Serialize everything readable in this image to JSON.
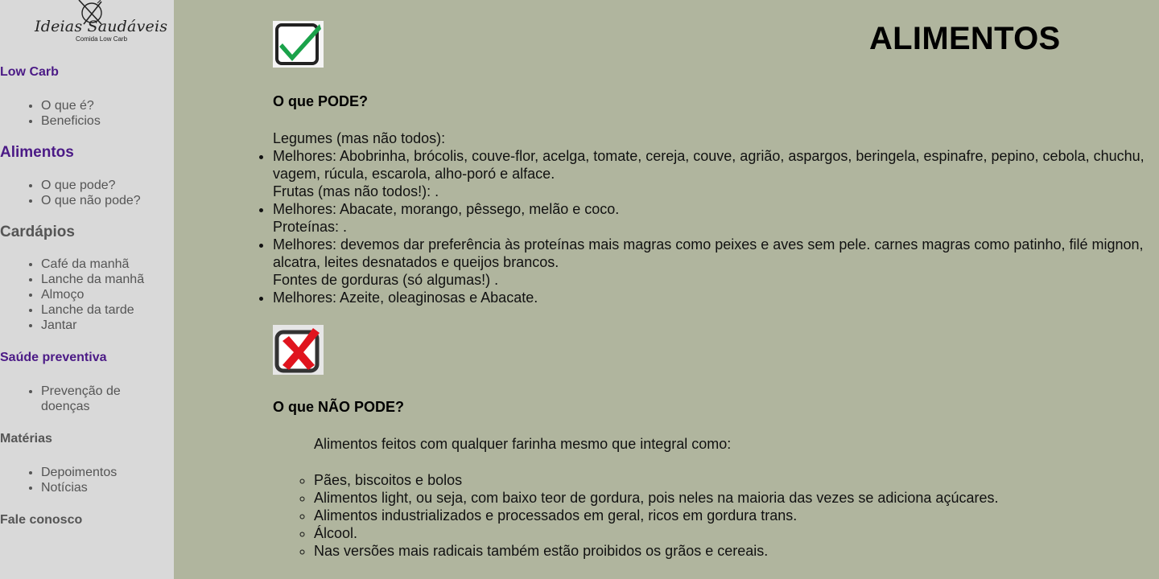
{
  "logo": {
    "script_text": "Ideias Saudáveis",
    "tagline": "Comida Low Carb",
    "icon": "fork-knife-plate-icon"
  },
  "sidebar": {
    "low_carb": {
      "title": "Low Carb",
      "items": [
        "O que é?",
        "Beneficios"
      ]
    },
    "alimentos": {
      "title": "Alimentos",
      "items": [
        "O que pode?",
        "O que não pode?"
      ]
    },
    "cardapios": {
      "title": "Cardápios",
      "items": [
        "Café da manhã",
        "Lanche da manhã",
        "Almoço",
        "Lanche da tarde",
        "Jantar"
      ]
    },
    "saude": {
      "title": "Saúde preventiva",
      "items": [
        "Prevenção de doenças"
      ]
    },
    "materias": {
      "title": "Matérias",
      "items": [
        "Depoimentos",
        "Notícias"
      ]
    },
    "fale": {
      "title": "Fale conosco"
    }
  },
  "main": {
    "title": "ALIMENTOS",
    "can": {
      "icon": "green-checkmark-icon",
      "heading": "O que PODE?",
      "groups": [
        {
          "category": "Legumes (mas não todos):",
          "best": "Melhores: Abobrinha, brócolis, couve-flor, acelga, tomate, cereja, couve, agrião, aspargos, beringela, espinafre, pepino, cebola, chuchu, vagem, rúcula, escarola, alho-poró e alface."
        },
        {
          "category": "Frutas (mas não todos!): .",
          "best": "Melhores: Abacate, morango, pêssego, melão e coco."
        },
        {
          "category": "Proteínas: .",
          "best": "Melhores: devemos dar preferência às proteínas mais magras como peixes e aves sem pele. carnes magras como patinho, filé mignon, alcatra, leites desnatados e queijos brancos."
        },
        {
          "category": "Fontes de gorduras (só algumas!) .",
          "best": "Melhores: Azeite, oleaginosas e Abacate."
        }
      ]
    },
    "cannot": {
      "icon": "red-x-icon",
      "heading": "O que NÃO PODE?",
      "intro": "Alimentos feitos com qualquer farinha mesmo que integral como:",
      "items": [
        "Pães, biscoitos e bolos",
        "Alimentos light, ou seja, com baixo teor de gordura, pois neles na maioria das vezes se adiciona açúcares.",
        "Alimentos industrializados e processados em geral, ricos em gordura trans.",
        "Álcool.",
        "Nas versões mais radicais também estão proibidos os grãos e cereais."
      ]
    }
  },
  "colors": {
    "page_bg": "#b0b59e",
    "sidebar_bg": "#d9d9d9",
    "link_purple": "#4b1a86",
    "link_gray": "#555555",
    "check_green": "#1aa24a",
    "x_red": "#e0141e"
  }
}
